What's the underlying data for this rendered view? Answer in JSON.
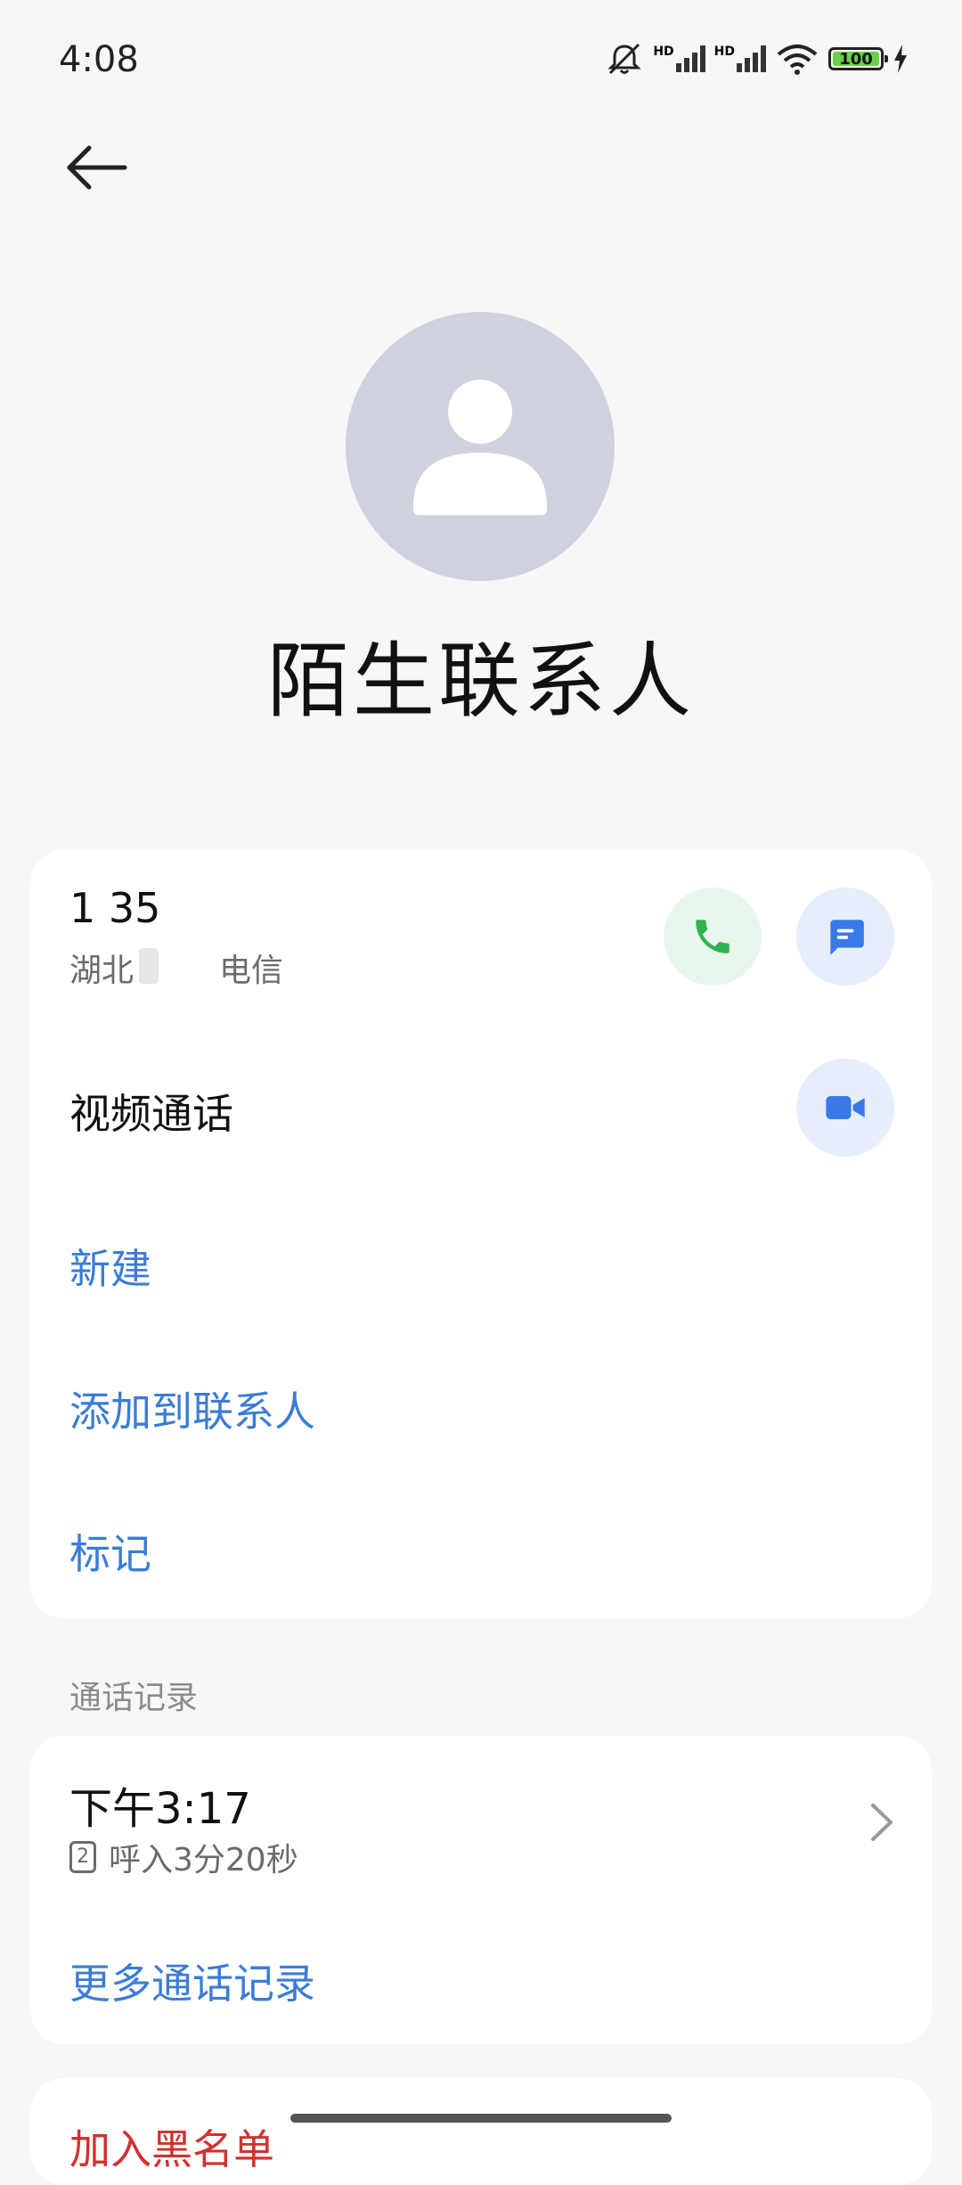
{
  "status_bar": {
    "time": "4:08",
    "hd1": "HD",
    "hd2": "HD",
    "battery": "100"
  },
  "contact": {
    "name": "陌生联系人",
    "number": "1            35",
    "location": "湖北",
    "carrier": "电信"
  },
  "actions": {
    "video_call": "视频通话",
    "new": "新建",
    "add_to_contacts": "添加到联系人",
    "mark": "标记"
  },
  "call_log": {
    "section_title": "通话记录",
    "entries": [
      {
        "time": "下午3:17",
        "sim": "2",
        "detail": "呼入3分20秒"
      }
    ],
    "more": "更多通话记录"
  },
  "blacklist": "加入黑名单",
  "colors": {
    "link": "#3b7cd6",
    "danger": "#d32f2f",
    "call_green": "#2db34f",
    "message_blue": "#3a78e6",
    "avatar_bg": "#cfd1de"
  }
}
